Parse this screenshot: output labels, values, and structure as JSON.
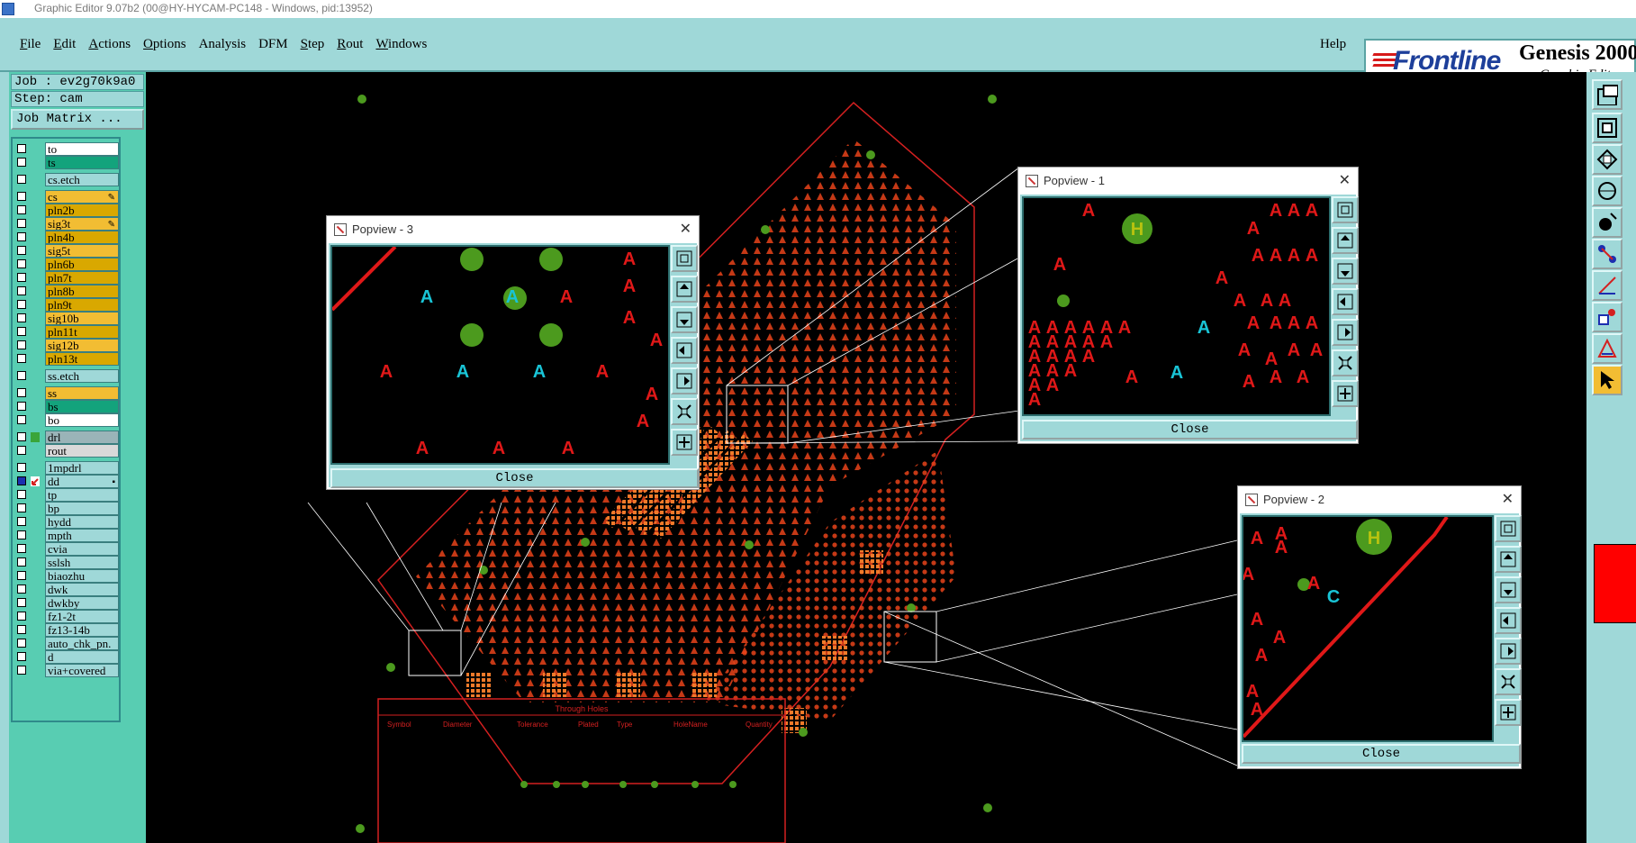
{
  "window": {
    "title": "Graphic Editor 9.07b2 (00@HY-HYCAM-PC148 - Windows, pid:13952)"
  },
  "menu": [
    {
      "label": "File",
      "key": "F",
      "rest": "ile"
    },
    {
      "label": "Edit",
      "key": "E",
      "rest": "dit"
    },
    {
      "label": "Actions",
      "key": "A",
      "rest": "ctions"
    },
    {
      "label": "Options",
      "key": "O",
      "rest": "ptions"
    },
    {
      "label": "Analysis",
      "key": "",
      "rest": "Analysis"
    },
    {
      "label": "DFM",
      "key": "",
      "rest": "DFM"
    },
    {
      "label": "Step",
      "key": "S",
      "rest": "tep"
    },
    {
      "label": "Rout",
      "key": "R",
      "rest": "out"
    },
    {
      "label": "Windows",
      "key": "W",
      "rest": "indows"
    }
  ],
  "help_label": "Help",
  "brand": {
    "logo": "Frontline",
    "product": "Genesis 2000",
    "subtitle": "Graphic Editor"
  },
  "job": {
    "job_line": "Job : ev2g70k9a0",
    "step_line": "Step: cam",
    "matrix_button": "Job Matrix ..."
  },
  "layers": [
    {
      "name": "to",
      "color": "#ffffff",
      "group": 0
    },
    {
      "name": "ts",
      "color": "#13a37c",
      "group": 0
    },
    {
      "name": "cs.etch",
      "color": "#9fd8d8",
      "group": 1
    },
    {
      "name": "cs",
      "color": "#f2bd33",
      "group": 2,
      "mark": "✎"
    },
    {
      "name": "pln2b",
      "color": "#d9a800",
      "group": 2
    },
    {
      "name": "sig3t",
      "color": "#f2bd33",
      "group": 2,
      "mark": "✎"
    },
    {
      "name": "pln4b",
      "color": "#d9a800",
      "group": 2
    },
    {
      "name": "sig5t",
      "color": "#f2bd33",
      "group": 2
    },
    {
      "name": "pln6b",
      "color": "#d9a800",
      "group": 2
    },
    {
      "name": "pln7t",
      "color": "#d9a800",
      "group": 2
    },
    {
      "name": "pln8b",
      "color": "#d9a800",
      "group": 2
    },
    {
      "name": "pln9t",
      "color": "#d9a800",
      "group": 2
    },
    {
      "name": "sig10b",
      "color": "#f2bd33",
      "group": 2
    },
    {
      "name": "pln11t",
      "color": "#d9a800",
      "group": 2
    },
    {
      "name": "sig12b",
      "color": "#f2bd33",
      "group": 2
    },
    {
      "name": "pln13t",
      "color": "#d9a800",
      "group": 2
    },
    {
      "name": "ss.etch",
      "color": "#9fd8d8",
      "group": 3
    },
    {
      "name": "ss",
      "color": "#f2bd33",
      "group": 4
    },
    {
      "name": "bs",
      "color": "#13a37c",
      "group": 4
    },
    {
      "name": "bo",
      "color": "#ffffff",
      "group": 4
    },
    {
      "name": "drl",
      "color": "#9ab4b8",
      "group": 5,
      "ind": "#3aa53a"
    },
    {
      "name": "rout",
      "color": "#d9d9d9",
      "group": 5
    },
    {
      "name": "1mpdrl",
      "color": "#9fd8d8",
      "group": 6
    },
    {
      "name": "dd",
      "color": "#9fd8d8",
      "group": 6,
      "ind": "pointer",
      "checked": true,
      "mark": "▪"
    },
    {
      "name": "tp",
      "color": "#9fd8d8",
      "group": 6
    },
    {
      "name": "bp",
      "color": "#9fd8d8",
      "group": 6
    },
    {
      "name": "hydd",
      "color": "#9fd8d8",
      "group": 6
    },
    {
      "name": "mpth",
      "color": "#9fd8d8",
      "group": 6
    },
    {
      "name": "cvia",
      "color": "#9fd8d8",
      "group": 6
    },
    {
      "name": "sslsh",
      "color": "#9fd8d8",
      "group": 6
    },
    {
      "name": "biaozhu",
      "color": "#9fd8d8",
      "group": 6
    },
    {
      "name": "dwk",
      "color": "#9fd8d8",
      "group": 6
    },
    {
      "name": "dwkby",
      "color": "#9fd8d8",
      "group": 6
    },
    {
      "name": "fz1-2t",
      "color": "#9fd8d8",
      "group": 6
    },
    {
      "name": "fz13-14b",
      "color": "#9fd8d8",
      "group": 6
    },
    {
      "name": "auto_chk_pn.",
      "color": "#9fd8d8",
      "group": 6
    },
    {
      "name": "d",
      "color": "#9fd8d8",
      "group": 6
    },
    {
      "name": "via+covered",
      "color": "#9fd8d8",
      "group": 6
    }
  ],
  "popviews": [
    {
      "id": "pv3",
      "title": "Popview - 3",
      "close_label": "Close"
    },
    {
      "id": "pv1",
      "title": "Popview - 1",
      "close_label": "Close"
    },
    {
      "id": "pv2",
      "title": "Popview - 2",
      "close_label": "Close"
    }
  ],
  "canvas_labels": {
    "table_title": "Through Holes",
    "table_headers": [
      "Symbol",
      "Diameter",
      "Tolerance",
      "Plated",
      "Type",
      "HoleName",
      "Quantity"
    ],
    "pad_letters": {
      "A": "A",
      "H": "H",
      "C": "C"
    }
  },
  "colors": {
    "background": "#9fd8d8",
    "panel": "#58cdb2",
    "canvas": "#000000",
    "copper": "#e8431a",
    "drill": "#4c9a1e",
    "highlight": "#19c4d6"
  }
}
